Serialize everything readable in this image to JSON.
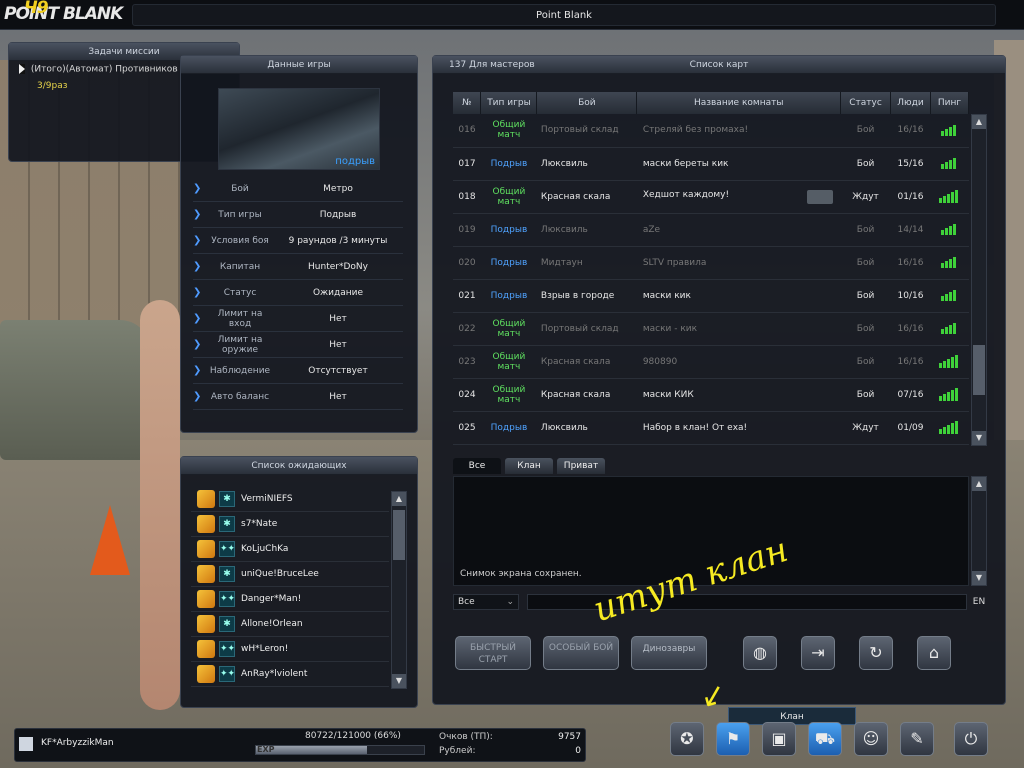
{
  "window": {
    "title": "Point Blank",
    "logo_text": "POINT BLANK",
    "logo_badge": "Ч9"
  },
  "mission": {
    "title": "Задачи миссии",
    "item": "(Итого)(Автомат) Противников",
    "count": "3/9раз"
  },
  "gamedata": {
    "title": "Данные игры",
    "preview_mode": "подрыв",
    "rows": [
      {
        "label": "Бой",
        "value": "Метро"
      },
      {
        "label": "Тип игры",
        "value": "Подрыв"
      },
      {
        "label": "Условия боя",
        "value": "9 раундов /3 минуты"
      },
      {
        "label": "Капитан",
        "value": "Hunter*DoNy"
      },
      {
        "label": "Статус",
        "value": "Ожидание"
      },
      {
        "label": "Лимит на вход",
        "value": "Нет"
      },
      {
        "label": "Лимит на оружие",
        "value": "Нет"
      },
      {
        "label": "Наблюдение",
        "value": "Отсутствует"
      },
      {
        "label": "Авто баланс",
        "value": "Нет"
      }
    ]
  },
  "waiting": {
    "title": "Список ожидающих",
    "players": [
      {
        "name": "VermiNIEFS",
        "clan": "✱"
      },
      {
        "name": "s7*Nate",
        "clan": "✱"
      },
      {
        "name": "KoLjuChKa",
        "clan": "✦✦"
      },
      {
        "name": "uniQue!BruceLee",
        "clan": "✱"
      },
      {
        "name": "Danger*Man!",
        "clan": "✦✦"
      },
      {
        "name": "Allone!Orlean",
        "clan": "✱"
      },
      {
        "name": "wH*Leron!",
        "clan": "✦✦"
      },
      {
        "name": "AnRay*lviolent",
        "clan": "✦✦"
      }
    ]
  },
  "maplist": {
    "server_label": "137 Для мастеров",
    "title": "Список карт",
    "columns": [
      "№",
      "Тип игры",
      "Бой",
      "Название комнаты",
      "Статус",
      "Люди",
      "Пинг"
    ],
    "rows": [
      {
        "no": "016",
        "type": "Общий матч",
        "type_kind": "dm",
        "map": "Портовый склад",
        "name": "Стреляй без промаха!",
        "status": "Бой",
        "people": "16/16",
        "ping": 4,
        "dim": true,
        "lock": false
      },
      {
        "no": "017",
        "type": "Подрыв",
        "type_kind": "bomb",
        "map": "Люксвиль",
        "name": "маски береты кик",
        "status": "Бой",
        "people": "15/16",
        "ping": 4,
        "dim": false,
        "lock": false
      },
      {
        "no": "018",
        "type": "Общий матч",
        "type_kind": "dm",
        "map": "Красная скала",
        "name": "Хедшот каждому!",
        "status": "Ждут",
        "people": "01/16",
        "ping": 5,
        "dim": false,
        "lock": true
      },
      {
        "no": "019",
        "type": "Подрыв",
        "type_kind": "bomb",
        "map": "Люксвиль",
        "name": "aZe",
        "status": "Бой",
        "people": "14/14",
        "ping": 4,
        "dim": true,
        "lock": false
      },
      {
        "no": "020",
        "type": "Подрыв",
        "type_kind": "bomb",
        "map": "Мидтаун",
        "name": "SLTV правила",
        "status": "Бой",
        "people": "16/16",
        "ping": 4,
        "dim": true,
        "lock": false
      },
      {
        "no": "021",
        "type": "Подрыв",
        "type_kind": "bomb",
        "map": "Взрыв в городе",
        "name": "маски кик",
        "status": "Бой",
        "people": "10/16",
        "ping": 4,
        "dim": false,
        "lock": false
      },
      {
        "no": "022",
        "type": "Общий матч",
        "type_kind": "dm",
        "map": "Портовый склад",
        "name": "маски - кик",
        "status": "Бой",
        "people": "16/16",
        "ping": 4,
        "dim": true,
        "lock": false
      },
      {
        "no": "023",
        "type": "Общий матч",
        "type_kind": "dm",
        "map": "Красная скала",
        "name": "980890",
        "status": "Бой",
        "people": "16/16",
        "ping": 5,
        "dim": true,
        "lock": false
      },
      {
        "no": "024",
        "type": "Общий матч",
        "type_kind": "dm",
        "map": "Красная скала",
        "name": "маски КИК",
        "status": "Бой",
        "people": "07/16",
        "ping": 5,
        "dim": false,
        "lock": false
      },
      {
        "no": "025",
        "type": "Подрыв",
        "type_kind": "bomb",
        "map": "Люксвиль",
        "name": "Набор в клан! От еха!",
        "status": "Ждут",
        "people": "01/09",
        "ping": 5,
        "dim": false,
        "lock": false
      }
    ]
  },
  "chat": {
    "tabs": [
      "Все",
      "Клан",
      "Приват"
    ],
    "message": "Снимок экрана сохранен.",
    "scope": "Все",
    "lang": "EN"
  },
  "actions": {
    "quick_start": "БЫСТРЫЙ СТАРТ",
    "special_battle": "ОСОБЫЙ БОЙ",
    "dinosaurs": "Динозавры"
  },
  "status": {
    "name": "KF*ArbyzzikMan",
    "exp_text": "80722/121000 (66%)",
    "exp_fraction": 0.66,
    "exp_label": "EXP",
    "points_label": "Очков (ТП):",
    "points_value": "9757",
    "rubles_label": "Рублей:",
    "rubles_value": "0"
  },
  "tooltip": "Клан",
  "graffiti": "итут клан",
  "colors": {
    "accent_blue": "#4fa3ff",
    "deathmatch_green": "#5fe060",
    "ping_green": "#3fd23a",
    "graffiti_yellow": "#f6ea22"
  }
}
